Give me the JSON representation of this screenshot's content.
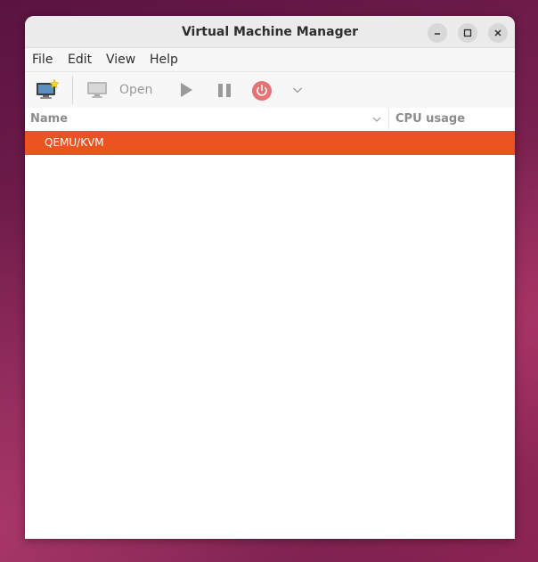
{
  "window": {
    "title": "Virtual Machine Manager"
  },
  "menubar": {
    "items": [
      {
        "label": "File"
      },
      {
        "label": "Edit"
      },
      {
        "label": "View"
      },
      {
        "label": "Help"
      }
    ]
  },
  "toolbar": {
    "new_vm_icon": "new-vm-icon",
    "open_icon": "monitor-icon",
    "open_label": "Open",
    "run_icon": "play-icon",
    "pause_icon": "pause-icon",
    "shutdown_icon": "power-icon",
    "shutdown_menu_icon": "chevron-down-icon"
  },
  "list": {
    "columns": [
      {
        "label": "Name"
      },
      {
        "label": "CPU usage"
      }
    ],
    "rows": [
      {
        "label": "QEMU/KVM",
        "selected": true
      }
    ]
  },
  "colors": {
    "selection": "#e95420",
    "power_accent": "#e57373"
  }
}
